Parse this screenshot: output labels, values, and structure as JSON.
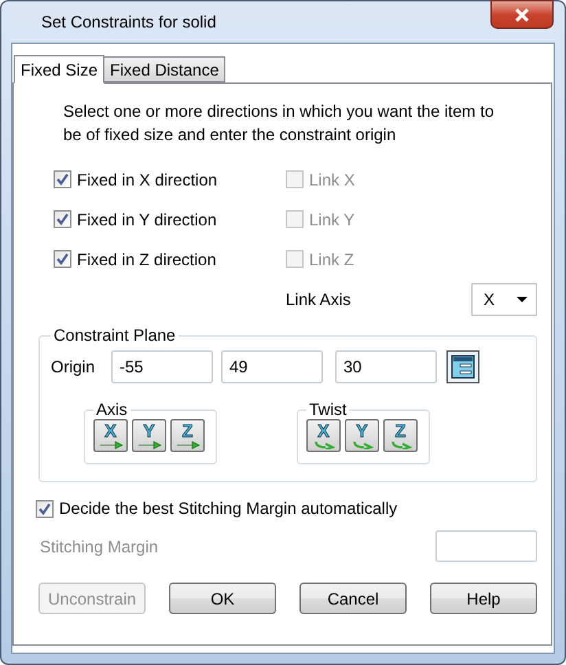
{
  "window": {
    "title": "Set Constraints for solid"
  },
  "tabs": [
    {
      "label": "Fixed Size",
      "selected": true
    },
    {
      "label": "Fixed Distance",
      "selected": false
    }
  ],
  "instructions": "Select one or more directions in which you want the item to be of fixed size and enter the constraint origin",
  "directions": [
    {
      "label": "Fixed in X direction",
      "checked": true,
      "link": {
        "label": "Link X",
        "checked": false,
        "disabled": true
      }
    },
    {
      "label": "Fixed in Y direction",
      "checked": true,
      "link": {
        "label": "Link Y",
        "checked": false,
        "disabled": true
      }
    },
    {
      "label": "Fixed in Z direction",
      "checked": true,
      "link": {
        "label": "Link Z",
        "checked": false,
        "disabled": true
      }
    }
  ],
  "link_axis": {
    "label": "Link Axis",
    "value": "X"
  },
  "constraint_plane": {
    "title": "Constraint Plane",
    "origin_label": "Origin",
    "origin": [
      "-55",
      "49",
      "30"
    ],
    "axis": {
      "title": "Axis",
      "buttons": [
        "X",
        "Y",
        "Z"
      ]
    },
    "twist": {
      "title": "Twist",
      "buttons": [
        "X",
        "Y",
        "Z"
      ]
    }
  },
  "auto_margin": {
    "label": "Decide the best Stitching Margin automatically",
    "checked": true
  },
  "stitching_margin": {
    "label": "Stitching Margin",
    "disabled": true
  },
  "buttons": [
    {
      "label": "Unconstrain",
      "disabled": true
    },
    {
      "label": "OK",
      "disabled": false
    },
    {
      "label": "Cancel",
      "disabled": false
    },
    {
      "label": "Help",
      "disabled": false
    }
  ]
}
